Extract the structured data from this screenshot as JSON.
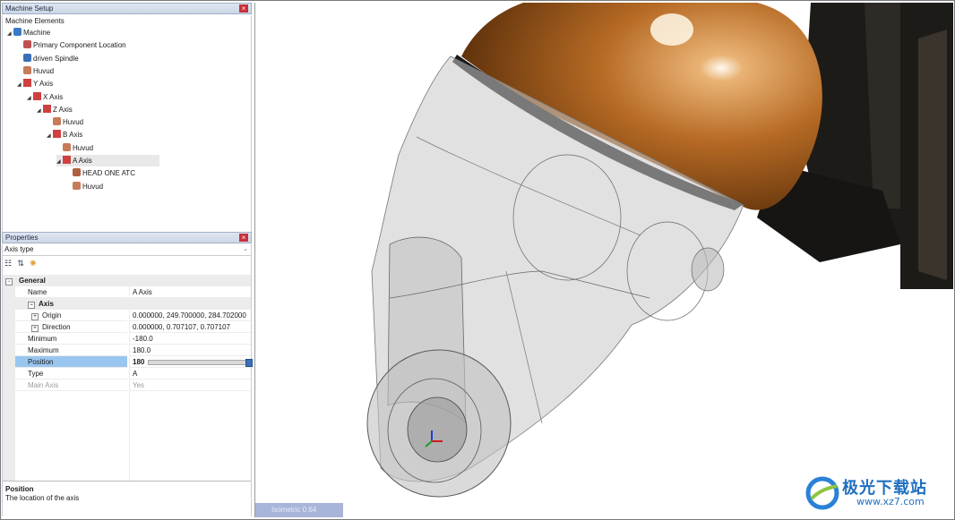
{
  "machine_setup": {
    "title": "Machine Setup",
    "close": "×",
    "section_label": "Machine Elements",
    "tree": [
      {
        "label": "Machine",
        "icon": "machine-icon",
        "depth": 0
      },
      {
        "label": "Primary Component Location",
        "icon": "component-location-icon",
        "depth": 1
      },
      {
        "label": "driven Spindle",
        "icon": "spindle-icon",
        "depth": 1
      },
      {
        "label": "Huvud",
        "icon": "body-icon",
        "depth": 1
      },
      {
        "label": "Y Axis",
        "icon": "axis-icon",
        "depth": 1
      },
      {
        "label": "X Axis",
        "icon": "axis-icon",
        "depth": 2
      },
      {
        "label": "Z Axis",
        "icon": "axis-icon",
        "depth": 3
      },
      {
        "label": "Huvud",
        "icon": "body-icon",
        "depth": 4
      },
      {
        "label": "B Axis",
        "icon": "axis-icon",
        "depth": 4
      },
      {
        "label": "Huvud",
        "icon": "body-icon",
        "depth": 5
      },
      {
        "label": "A Axis",
        "icon": "axis-icon",
        "depth": 5,
        "selected": true
      },
      {
        "label": "HEAD ONE ATC",
        "icon": "tool-icon",
        "depth": 6
      },
      {
        "label": "Huvud",
        "icon": "body-icon",
        "depth": 6
      }
    ]
  },
  "properties": {
    "title": "Properties",
    "close": "×",
    "type_combo": "Axis type",
    "combo_arrow": "⌄",
    "toolbar": [
      "categorized-icon",
      "sort-az-icon",
      "property-pages-icon"
    ],
    "toolbar_glyphs": [
      "☷",
      "⇅",
      "✺"
    ],
    "rows": {
      "general": "General",
      "name_label": "Name",
      "name_value": "A Axis",
      "axis": "Axis",
      "origin_label": "Origin",
      "origin_value": "0.000000, 249.700000, 284.702000",
      "direction_label": "Direction",
      "direction_value": "0.000000, 0.707107, 0.707107",
      "minimum_label": "Minimum",
      "minimum_value": "-180.0",
      "maximum_label": "Maximum",
      "maximum_value": "180.0",
      "position_label": "Position",
      "position_value": "180",
      "position_fraction": 1.0,
      "type_label": "Type",
      "type_value": "A",
      "main_axis_label": "Main Axis",
      "main_axis_value": "Yes"
    },
    "description": {
      "heading": "Position",
      "text": "The location of the axis"
    }
  },
  "viewport": {
    "view_label": "Isometric 0.64"
  },
  "watermark": {
    "brand": "极光下载站",
    "url": "www.xz7.com"
  }
}
